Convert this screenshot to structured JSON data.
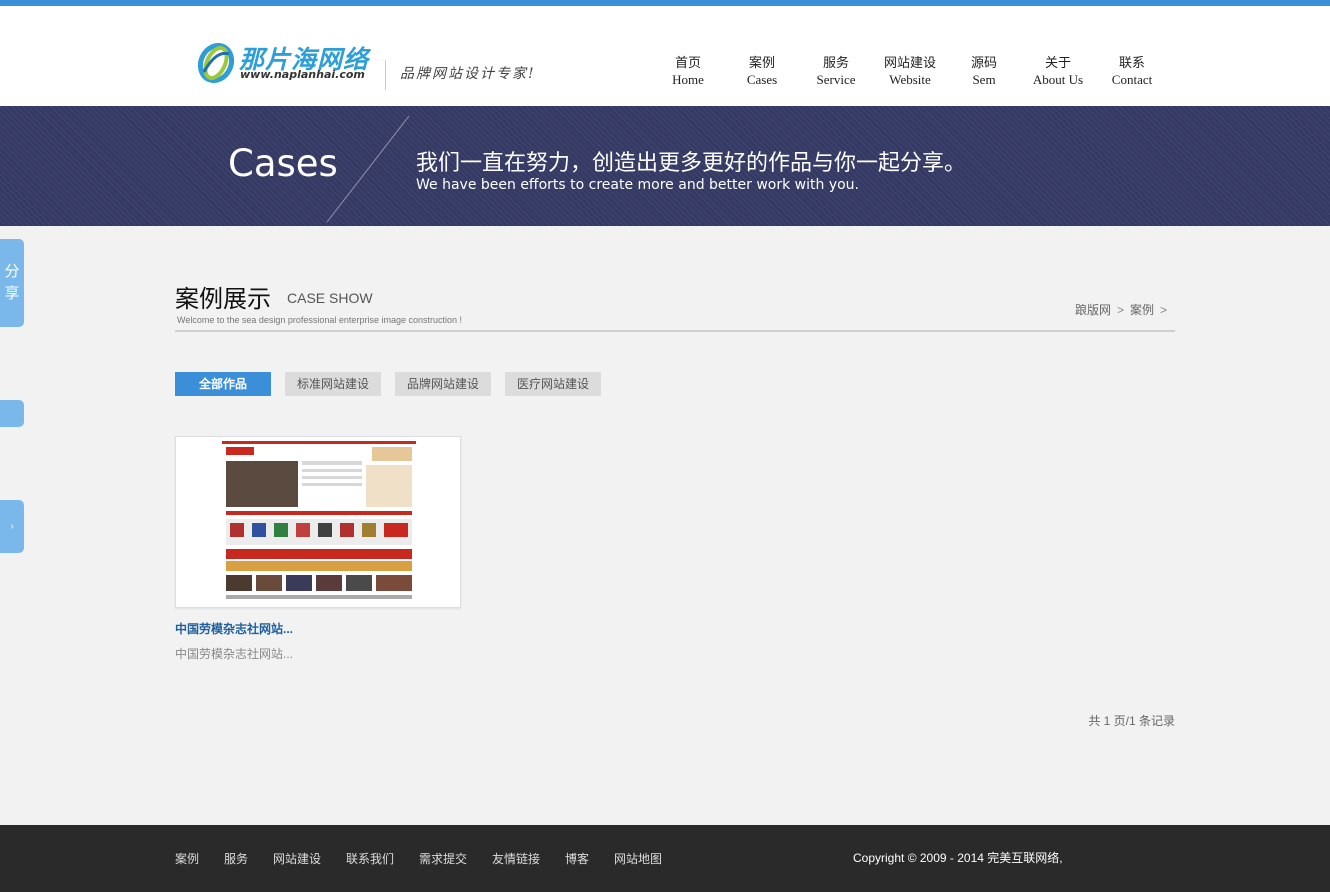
{
  "brand": {
    "name": "那片海网络",
    "url": "www.naplanhai.com",
    "slogan": "品牌网站设计专家!"
  },
  "nav": [
    {
      "cn": "首页",
      "en": "Home"
    },
    {
      "cn": "案例",
      "en": "Cases"
    },
    {
      "cn": "服务",
      "en": "Service"
    },
    {
      "cn": "网站建设",
      "en": "Website"
    },
    {
      "cn": "源码",
      "en": "Sem"
    },
    {
      "cn": "关于",
      "en": "About Us"
    },
    {
      "cn": "联系",
      "en": "Contact"
    }
  ],
  "banner": {
    "title": "Cases",
    "cn": "我们一直在努力，创造出更多更好的作品与你一起分享。",
    "en": "We have been efforts to create more and better work with you."
  },
  "side": {
    "share": "分享"
  },
  "section": {
    "title": "案例展示",
    "title_en": "CASE SHOW",
    "subtitle": "Welcome to the sea design professional enterprise image construction !",
    "breadcrumb": [
      "踉版网",
      "案例"
    ]
  },
  "filters": [
    {
      "label": "全部作品",
      "active": true
    },
    {
      "label": "标准网站建设",
      "active": false
    },
    {
      "label": "品牌网站建设",
      "active": false
    },
    {
      "label": "医疗网站建设",
      "active": false
    }
  ],
  "cases": [
    {
      "title": "中国劳模杂志社网站...",
      "desc": "中国劳模杂志社网站..."
    }
  ],
  "pagination": {
    "text": "共 1 页/1 条记录"
  },
  "footer": {
    "links": [
      "案例",
      "服务",
      "网站建设",
      "联系我们",
      "需求提交",
      "友情链接",
      "博客",
      "网站地图"
    ],
    "copyright": "Copyright © 2009 - 2014 完美互联网络,"
  },
  "colors": {
    "accent": "#3a8fd8",
    "banner": "#353a64",
    "footer": "#2a2a2a",
    "side_tab": "#7ab8ec"
  }
}
